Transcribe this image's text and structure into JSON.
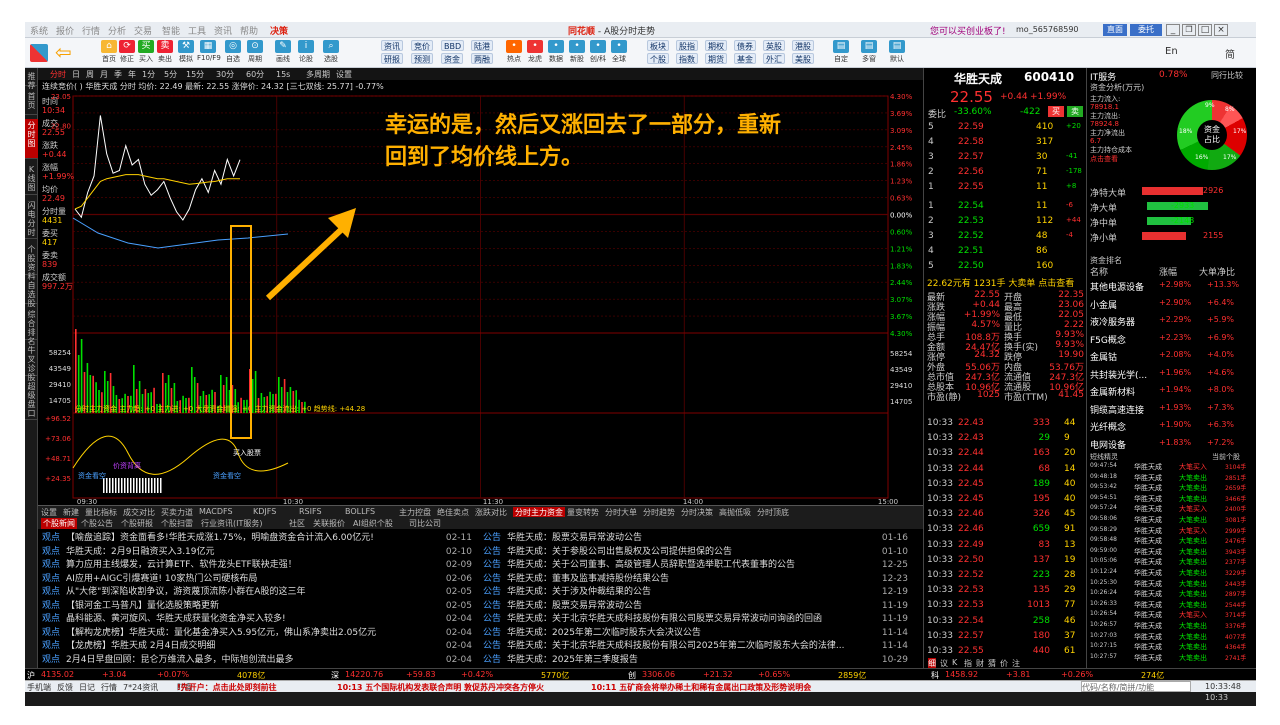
{
  "window": {
    "title": "同花顺 - A股分时走势",
    "notice": "您可以买创业板了!",
    "user": "mo_565768590",
    "btn_direct": "直面",
    "btn_entrust": "委托"
  },
  "menu": [
    "系统",
    "报价",
    "行情",
    "分析",
    "交易",
    "智能",
    "工具",
    "资讯",
    "帮助",
    "决策"
  ],
  "toolbar": {
    "icons": [
      {
        "icon": "back-arrow-icon",
        "label": ""
      },
      {
        "icon": "home-icon",
        "label": "首页"
      },
      {
        "icon": "refresh-icon",
        "label": "修正"
      },
      {
        "icon": "alarm-icon",
        "label": "买入"
      },
      {
        "icon": "buy-icon",
        "label": "卖出"
      },
      {
        "icon": "sell-icon",
        "label": "模拟"
      },
      {
        "icon": "hammer-icon",
        "label": "F10/F9"
      },
      {
        "icon": "grid-icon",
        "label": "自选"
      },
      {
        "icon": "clock-icon",
        "label": "周期"
      },
      {
        "icon": "pen-icon",
        "label": "画线"
      },
      {
        "icon": "iwen-icon",
        "label": "论股"
      },
      {
        "icon": "search-icon",
        "label": "选股"
      }
    ],
    "small": [
      "资讯",
      "竞价",
      "BBD",
      "陆港",
      "研报",
      "预测",
      "资金",
      "两融"
    ],
    "icons2": [
      "热点",
      "龙虎",
      "数据",
      "新股",
      "创/科",
      "全球"
    ],
    "small2": [
      "板块",
      "股指",
      "期权",
      "债券",
      "英股",
      "港股",
      "个股",
      "指数",
      "期货",
      "基金",
      "外汇",
      "美股"
    ],
    "icons3": [
      "自定",
      "多窗",
      "默认"
    ],
    "right": [
      "En",
      "简"
    ]
  },
  "sidebar": [
    "推荐",
    "首页",
    "分时图",
    "K线图",
    "闪电分时",
    "个股资料",
    "自选股",
    "综合排名",
    "牛叉诊股",
    "超级盘口"
  ],
  "chart": {
    "period_tabs": [
      "分时",
      "日",
      "周",
      "月",
      "季",
      "年",
      "1分",
      "5分",
      "15分",
      "30分",
      "60分",
      "15s",
      "多周期",
      "设置"
    ],
    "info": "连续竞价( )  华胜天成  分时  均价: 22.49  最新: 22.55  涨停价: 24.32  [三七双线: 25.77]  -0.77%",
    "left_labels": [
      {
        "k": "时间",
        "v": "10:34"
      },
      {
        "k": "成交",
        "v": "22.55"
      },
      {
        "k": "涨跌",
        "v": "+0.44"
      },
      {
        "k": "涨幅",
        "v": "+1.99%"
      },
      {
        "k": "均价",
        "v": "22.49"
      },
      {
        "k": "分时量",
        "v": "4431"
      },
      {
        "k": "委买",
        "v": "417"
      },
      {
        "k": "委卖",
        "v": "839"
      },
      {
        "k": "成交额",
        "v": "997.2万"
      }
    ],
    "yleft": [
      "23.05",
      "22.80",
      "22.55",
      "22.30",
      "22.05",
      "21.80",
      "21.55",
      "21.30",
      "21.05",
      "58254",
      "43549",
      "29410",
      "14705"
    ],
    "yleft_top": "23.05",
    "yright": [
      "4.30%",
      "3.69%",
      "3.09%",
      "2.45%",
      "1.86%",
      "1.23%",
      "0.63%",
      "0.00%",
      "0.60%",
      "1.21%",
      "1.83%",
      "2.44%",
      "3.07%",
      "3.67%",
      "4.30%",
      "58254",
      "43549",
      "29410",
      "14705"
    ],
    "ind_title": "分时主力资金  主力趋: +0  主力进: +0  大盘资金增强: +0  主力资金流出: +0  趋势线: +44.28",
    "ind_y": [
      "+96.52",
      "+73.06",
      "+48.71",
      "+24.35"
    ],
    "tags": [
      "资金看空",
      "价资背离",
      "资金看空",
      "买入股票"
    ],
    "xticks": [
      "09:30",
      "10:30",
      "11:30",
      "14:00",
      "15:00"
    ],
    "callout": [
      "幸运的是，然后又涨回去了一部分，重新",
      "回到了均价线上方。"
    ],
    "price_series": [
      0.2,
      -0.1,
      0.8,
      1.4,
      3.6,
      2.2,
      1.5,
      1.6,
      2.5,
      1.8,
      2.0,
      1.1,
      0.7,
      0.9,
      1.2,
      0.6,
      0.1,
      -0.2,
      0.2,
      0.9,
      1.3,
      0.8,
      1.6,
      1.1,
      2.0,
      1.4,
      1.99
    ],
    "avg_series": [
      0.2,
      0.3,
      0.6,
      0.9,
      1.2,
      1.3,
      1.35,
      1.4,
      1.45,
      1.45,
      1.45,
      1.4,
      1.35,
      1.3,
      1.3,
      1.25,
      1.2,
      1.15,
      1.1,
      1.12,
      1.15,
      1.18,
      1.2,
      1.25,
      1.3,
      1.3,
      1.3
    ]
  },
  "bottom_tabs": [
    "设置",
    "新建",
    "量比指标",
    "成交对比",
    "买卖力道",
    "MACDFS",
    "KDJFS",
    "RSIFS",
    "BOLLFS",
    "主力控盘",
    "绝佳卖点",
    "涨跌对比",
    "分时主力资金",
    "量变转势",
    "分时大单",
    "分时趋势",
    "分时决策",
    "高抛低吸",
    "分时顶底"
  ],
  "news_tabs": [
    "个股新闻",
    "个股公告",
    "个股研报",
    "个股扫雷",
    "行业资讯(IT服务)",
    "社区",
    "关联报价",
    "AI组织个股",
    "司比公司"
  ],
  "news_left": [
    {
      "tag": "观点",
      "t": "【喻盘追踪】资金面看多!华胜天成涨1.75%，明喻盘资金合计流入6.00亿元!",
      "d": "02-11"
    },
    {
      "tag": "观点",
      "t": "华胜天成：2月9日融资买入3.19亿元",
      "d": "02-10"
    },
    {
      "tag": "观点",
      "t": "算力应用主线爆发，云计算ETF、软件龙头ETF联袂走强！",
      "d": "02-09"
    },
    {
      "tag": "观点",
      "t": "AI应用+AIGC引爆赛道! 10家热门公司硬核布局",
      "d": "02-06"
    },
    {
      "tag": "观点",
      "t": "从\"大佬\"到深陷收割争议，游资蔑顶流陈小群在A股的这三年",
      "d": "02-05"
    },
    {
      "tag": "观点",
      "t": "【银河金工马普凡】量化选股策略更新",
      "d": "02-05"
    },
    {
      "tag": "观点",
      "t": "晶科能源、黄河旋风、华胜天成获量化资金净买入较多!",
      "d": "02-04"
    },
    {
      "tag": "观点",
      "t": "【解构龙虎榜】华胜天成：量化基金净买入5.95亿元，佛山系净卖出2.05亿元",
      "d": "02-04"
    },
    {
      "tag": "观点",
      "t": "【龙虎榜】华胜天成 2月4日成交明细",
      "d": "02-04"
    },
    {
      "tag": "观点",
      "t": "2月4日早盘回顾：昆仑万维流入最多，中际旭创流出最多",
      "d": "02-04"
    }
  ],
  "news_right": [
    {
      "tag": "公告",
      "t": "华胜天成：股票交易异常波动公告",
      "d": "01-16"
    },
    {
      "tag": "公告",
      "t": "华胜天成：关于参股公司出售股权及公司提供担保的公告",
      "d": "01-10"
    },
    {
      "tag": "公告",
      "t": "华胜天成：关于公司董事、高级管理人员辞职暨选举职工代表董事的公告",
      "d": "12-25"
    },
    {
      "tag": "公告",
      "t": "华胜天成：董事及监事减持股份结果公告",
      "d": "12-23"
    },
    {
      "tag": "公告",
      "t": "华胜天成：关于涉及仲裁结果的公告",
      "d": "12-19"
    },
    {
      "tag": "公告",
      "t": "华胜天成：股票交易异常波动公告",
      "d": "11-19"
    },
    {
      "tag": "公告",
      "t": "华胜天成：关于北京华胜天成科技股份有限公司股票交易异常波动问询函的回函",
      "d": "11-19"
    },
    {
      "tag": "公告",
      "t": "华胜天成：2025年第二次临时股东大会决议公告",
      "d": "11-14"
    },
    {
      "tag": "公告",
      "t": "华胜天成：关于北京华胜天成科技股份有限公司2025年第二次临时股东大会的法律...",
      "d": "11-14"
    },
    {
      "tag": "公告",
      "t": "华胜天成：2025年第三季度报告",
      "d": "10-29"
    }
  ],
  "quote": {
    "name": "华胜天成",
    "code": "600410",
    "price": "22.55",
    "chg": "+0.44",
    "pct": "+1.99%",
    "wb": "-33.60%",
    "wc": "-422",
    "buy": "买",
    "sell": "卖",
    "asks": [
      [
        "5",
        "22.59",
        "410",
        "+20"
      ],
      [
        "4",
        "22.58",
        "317",
        ""
      ],
      [
        "3",
        "22.57",
        "30",
        "-41"
      ],
      [
        "2",
        "22.56",
        "71",
        "-178"
      ],
      [
        "1",
        "22.55",
        "11",
        "+8"
      ]
    ],
    "bids": [
      [
        "1",
        "22.54",
        "11",
        "-6"
      ],
      [
        "2",
        "22.53",
        "112",
        "+44"
      ],
      [
        "3",
        "22.52",
        "48",
        "-4"
      ],
      [
        "4",
        "22.51",
        "86",
        ""
      ],
      [
        "5",
        "22.50",
        "160",
        ""
      ]
    ],
    "summary": "22.62元有  1231手  大卖单  点击查看",
    "stats": [
      [
        "最新",
        "22.55",
        "开盘",
        "22.35"
      ],
      [
        "涨跌",
        "+0.44",
        "最高",
        "23.06"
      ],
      [
        "涨幅",
        "+1.99%",
        "最低",
        "22.05"
      ],
      [
        "振幅",
        "4.57%",
        "量比",
        "2.22"
      ],
      [
        "总手",
        "108.8万",
        "换手",
        "9.93%"
      ],
      [
        "金额",
        "24.47亿",
        "换手(实)",
        "9.93%"
      ],
      [
        "涨停",
        "24.32",
        "跌停",
        "19.90"
      ],
      [
        "外盘",
        "55.06万",
        "内盘",
        "53.76万"
      ],
      [
        "总市值",
        "247.3亿",
        "流通值",
        "247.3亿"
      ],
      [
        "总股本",
        "10.96亿",
        "流通股",
        "10.96亿"
      ],
      [
        "市盈(静)",
        "1025",
        "市盈(TTM)",
        "41.45"
      ]
    ],
    "ticks": [
      [
        "10:33",
        "22.43",
        "333",
        "44"
      ],
      [
        "10:33",
        "22.43",
        "29",
        "9"
      ],
      [
        "10:33",
        "22.44",
        "163",
        "20"
      ],
      [
        "10:33",
        "22.44",
        "68",
        "14"
      ],
      [
        "10:33",
        "22.45",
        "189",
        "40"
      ],
      [
        "10:33",
        "22.45",
        "195",
        "40"
      ],
      [
        "10:33",
        "22.46",
        "326",
        "45"
      ],
      [
        "10:33",
        "22.46",
        "659",
        "91"
      ],
      [
        "10:33",
        "22.49",
        "83",
        "13"
      ],
      [
        "10:33",
        "22.50",
        "137",
        "19"
      ],
      [
        "10:33",
        "22.52",
        "223",
        "28"
      ],
      [
        "10:33",
        "22.53",
        "135",
        "29"
      ],
      [
        "10:33",
        "22.53",
        "1013",
        "77"
      ],
      [
        "10:33",
        "22.54",
        "258",
        "46"
      ],
      [
        "10:33",
        "22.57",
        "180",
        "37"
      ],
      [
        "10:33",
        "22.55",
        "440",
        "61"
      ]
    ],
    "tick_tabs": [
      "细",
      "议",
      "K",
      "指",
      "财",
      "猜",
      "价",
      "注"
    ]
  },
  "far": {
    "sector": "IT服务",
    "sector_pct": "0.78%",
    "sector_more": "同行比较",
    "flow_title": "资金分析(万元)",
    "flow_lines": [
      "主力流入:",
      "78918.1",
      "主力流出:",
      "78924.8",
      "主力净流出",
      "6.7",
      "主力持仓成本",
      "点击查看"
    ],
    "donut_labels": [
      "9%",
      "8%",
      "18%",
      "17%",
      "16%",
      "17%"
    ],
    "donut_center": "资金\n占比",
    "net": [
      {
        "k": "净特大单",
        "v": "2926",
        "w": 0.55,
        "c": "#e83030"
      },
      {
        "k": "净大单",
        "v": "-2933",
        "w": 0.55,
        "c": "#20c040"
      },
      {
        "k": "净中单",
        "v": "-2148",
        "w": 0.4,
        "c": "#20c040"
      },
      {
        "k": "净小单",
        "v": "2155",
        "w": 0.4,
        "c": "#e83030"
      }
    ],
    "rank_title": "资金排名",
    "rank_head": [
      "名称",
      "涨幅",
      "大单净比"
    ],
    "rank": [
      [
        "其他电源设备",
        "+2.98%",
        "+13.3%"
      ],
      [
        "小金属",
        "+2.90%",
        "+6.4%"
      ],
      [
        "液冷服务器",
        "+2.29%",
        "+5.9%"
      ],
      [
        "F5G概念",
        "+2.23%",
        "+6.9%"
      ],
      [
        "金属钴",
        "+2.08%",
        "+4.0%"
      ],
      [
        "共封装光学(...",
        "+1.96%",
        "+4.6%"
      ],
      [
        "金属新材料",
        "+1.94%",
        "+8.0%"
      ],
      [
        "铜缆高速连接",
        "+1.93%",
        "+7.3%"
      ],
      [
        "光纤概念",
        "+1.90%",
        "+6.3%"
      ],
      [
        "电网设备",
        "+1.83%",
        "+7.2%"
      ]
    ],
    "wiz_title": "短线精灵",
    "wiz_sel": "当前个股",
    "wiz": [
      [
        "09:47:54",
        "华胜天成",
        "大笔买入",
        "3104手"
      ],
      [
        "09:48:18",
        "华胜天成",
        "大笔卖出",
        "2851手"
      ],
      [
        "09:53:42",
        "华胜天成",
        "大笔卖出",
        "2659手"
      ],
      [
        "09:54:51",
        "华胜天成",
        "大笔卖出",
        "3466手"
      ],
      [
        "09:57:24",
        "华胜天成",
        "大笔买入",
        "2400手"
      ],
      [
        "09:58:06",
        "华胜天成",
        "大笔卖出",
        "3081手"
      ],
      [
        "09:58:29",
        "华胜天成",
        "大笔买入",
        "2999手"
      ],
      [
        "09:58:48",
        "华胜天成",
        "大笔卖出",
        "2476手"
      ],
      [
        "09:59:00",
        "华胜天成",
        "大笔卖出",
        "3943手"
      ],
      [
        "10:05:06",
        "华胜天成",
        "大笔卖出",
        "2377手"
      ],
      [
        "10:12:24",
        "华胜天成",
        "大笔卖出",
        "3229手"
      ],
      [
        "10:25:30",
        "华胜天成",
        "大笔卖出",
        "2443手"
      ],
      [
        "10:26:24",
        "华胜天成",
        "大笔卖出",
        "2897手"
      ],
      [
        "10:26:33",
        "华胜天成",
        "大笔卖出",
        "2544手"
      ],
      [
        "10:26:54",
        "华胜天成",
        "大笔买入",
        "3714手"
      ],
      [
        "10:26:57",
        "华胜天成",
        "大笔卖出",
        "3376手"
      ],
      [
        "10:27:03",
        "华胜天成",
        "大笔卖出",
        "4077手"
      ],
      [
        "10:27:15",
        "华胜天成",
        "大笔卖出",
        "4364手"
      ],
      [
        "10:27:57",
        "华胜天成",
        "大笔卖出",
        "2741手"
      ]
    ]
  },
  "status": {
    "items": [
      [
        "沪",
        "4135.02",
        "+3.04",
        "+0.07%",
        "4078亿"
      ],
      [
        "深",
        "14220.76",
        "+59.83",
        "+0.42%",
        "5770亿"
      ],
      [
        "创",
        "3306.06",
        "+21.32",
        "+0.65%",
        "2859亿"
      ],
      [
        "科",
        "1458.92",
        "+3.81",
        "+0.26%",
        "274亿"
      ]
    ]
  },
  "ticker": {
    "left": [
      "手机端",
      "反馈",
      "日记",
      "行情",
      "7*24资讯",
      "盯盘"
    ],
    "msg1": "!先开户：点击此处即刻前往",
    "msg2": "10:13 五个国际机构发表联合声明 敦促苏丹冲突各方停火",
    "msg3": "10:11 五矿商会将举办稀土和稀有金属出口政策及形势说明会",
    "search": "代码/名称/简拼/功能",
    "time": "10:33:48"
  },
  "taskbar": {
    "time": "10:33"
  }
}
